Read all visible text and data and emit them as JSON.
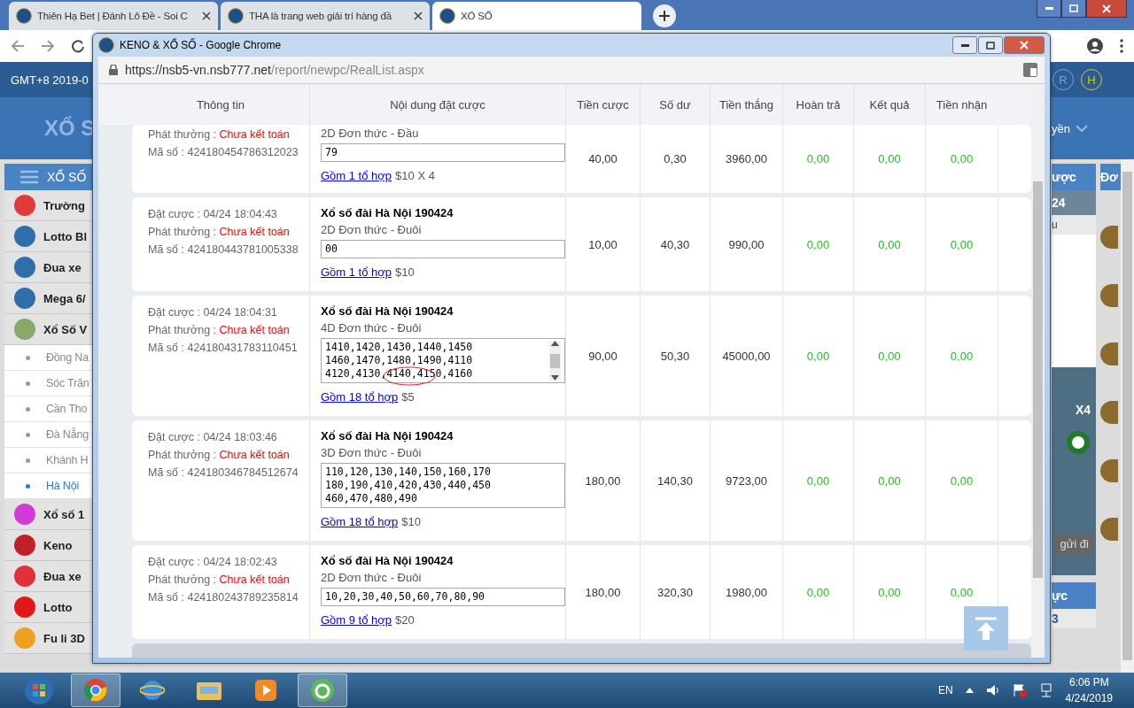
{
  "browser": {
    "tabs": [
      {
        "title": "Thiên Hạ Bet | Đánh Lô Đề - Soi C",
        "selected": false
      },
      {
        "title": "THA là trang web giải trí hàng đầ",
        "selected": false
      },
      {
        "title": "XỔ SỐ",
        "selected": true
      }
    ]
  },
  "page": {
    "timezone": "GMT+8 2019-0",
    "title": "XỔ S",
    "menu_title": "XỔ SỐ",
    "sidebar": [
      {
        "kind": "game",
        "label": "Trường",
        "color": "#e03a3a"
      },
      {
        "kind": "game",
        "label": "Lotto Bl",
        "color": "#2f6ea8"
      },
      {
        "kind": "game",
        "label": "Đua xe",
        "color": "#2f6ea8"
      },
      {
        "kind": "game",
        "label": "Mega 6/",
        "color": "#2f6ea8"
      },
      {
        "kind": "game",
        "label": "Xổ Số V",
        "color": "#8aa86a"
      },
      {
        "kind": "region",
        "label": "Đồng Na",
        "selected": false
      },
      {
        "kind": "region",
        "label": "Sóc Trăn",
        "selected": false
      },
      {
        "kind": "region",
        "label": "Cần Tho",
        "selected": false
      },
      {
        "kind": "region",
        "label": "Đà Nẵng",
        "selected": false
      },
      {
        "kind": "region",
        "label": "Khánh H",
        "selected": false
      },
      {
        "kind": "region",
        "label": "Hà Nội",
        "selected": true
      },
      {
        "kind": "game",
        "label": "Xổ số 1",
        "color": "#d23cd6"
      },
      {
        "kind": "game",
        "label": "Keno",
        "color": "#c0202a"
      },
      {
        "kind": "game",
        "label": "Đua xe",
        "color": "#e0303a"
      },
      {
        "kind": "game",
        "label": "Lotto",
        "color": "#e01818"
      },
      {
        "kind": "game",
        "label": "Fu li 3D",
        "color": "#f0a020"
      }
    ],
    "right_panel": {
      "badges": [
        "R",
        "H"
      ],
      "menu_text": "yền",
      "panel_title": "ược",
      "side_title": "Đơ",
      "date": "24",
      "sub": "u",
      "multiplier": "X4",
      "send": "gửi đi",
      "bottom_title": "ực",
      "bottom_value": "3"
    }
  },
  "popup": {
    "title": "KENO & XỔ SỐ - Google Chrome",
    "url_host": "https://nsb5-vn.nsb777.net",
    "url_path": "/report/newpc/RealList.aspx",
    "columns": [
      "Thông tin",
      "Nội dung đặt cược",
      "Tiền cược",
      "Số dư",
      "Tiền thắng",
      "Hoàn trả",
      "Kết quả",
      "Tiền nhận"
    ],
    "rows": [
      {
        "payout_label": "Phát thưởng : ",
        "status": "Chưa kết toán",
        "code": "Mã số : 424180454786312023",
        "bet_type": "2D Đơn thức - Đầu",
        "numbers": [
          "79"
        ],
        "scrollable": false,
        "combo_link": "Gồm 1 tổ hợp",
        "combo_price": "$10 X 4",
        "stake": "40,00",
        "balance": "0,30",
        "win": "3960,00",
        "refund": "0,00",
        "result": "0,00",
        "payout": "0,00"
      },
      {
        "bet_time": "Đặt cược : 04/24 18:04:43",
        "payout_label": "Phát thưởng : ",
        "status": "Chưa kết toán",
        "code": "Mã số : 424180443781005338",
        "game": "Xổ số đài Hà Nội 190424",
        "bet_type": "2D Đơn thức - Đuôi",
        "numbers": [
          "00"
        ],
        "scrollable": false,
        "combo_link": "Gồm 1 tổ hợp",
        "combo_price": "$10",
        "stake": "10,00",
        "balance": "40,30",
        "win": "990,00",
        "refund": "0,00",
        "result": "0,00",
        "payout": "0,00"
      },
      {
        "bet_time": "Đặt cược : 04/24 18:04:31",
        "payout_label": "Phát thưởng : ",
        "status": "Chưa kết toán",
        "code": "Mã số : 424180431783110451",
        "game": "Xổ số đài Hà Nội 190424",
        "bet_type": "4D Đơn thức - Đuôi",
        "numbers": [
          "1410,1420,1430,1440,1450",
          "1460,1470,1480,1490,4110",
          "4120,4130,4140,4150,4160"
        ],
        "scrollable": true,
        "annotation": {
          "kind": "ellipse"
        },
        "combo_link": "Gồm 18 tổ hợp",
        "combo_price": "$5",
        "stake": "90,00",
        "balance": "50,30",
        "win": "45000,00",
        "refund": "0,00",
        "result": "0,00",
        "payout": "0,00"
      },
      {
        "bet_time": "Đặt cược : 04/24 18:03:46",
        "payout_label": "Phát thưởng : ",
        "status": "Chưa kết toán",
        "code": "Mã số : 424180346784512674",
        "game": "Xổ số đài Hà Nội 190424",
        "bet_type": "3D Đơn thức - Đuôi",
        "numbers": [
          "110,120,130,140,150,160,170",
          "180,190,410,420,430,440,450",
          "460,470,480,490"
        ],
        "scrollable": false,
        "combo_link": "Gồm 18 tổ hợp",
        "combo_price": "$10",
        "stake": "180,00",
        "balance": "140,30",
        "win": "9723,00",
        "refund": "0,00",
        "result": "0,00",
        "payout": "0,00"
      },
      {
        "bet_time": "Đặt cược : 04/24 18:02:43",
        "payout_label": "Phát thưởng : ",
        "status": "Chưa kết toán",
        "code": "Mã số : 424180243789235814",
        "game": "Xổ số đài Hà Nội 190424",
        "bet_type": "2D Đơn thức - Đuôi",
        "numbers": [
          "10,20,30,40,50,60,70,80,90"
        ],
        "scrollable": false,
        "combo_link": "Gồm 9 tổ hợp",
        "combo_price": "$20",
        "stake": "180,00",
        "balance": "320,30",
        "win": "1980,00",
        "refund": "0,00",
        "result": "0,00",
        "payout": "0,00"
      }
    ]
  },
  "taskbar": {
    "language": "EN",
    "time": "6:06 PM",
    "date": "4/24/2019"
  }
}
